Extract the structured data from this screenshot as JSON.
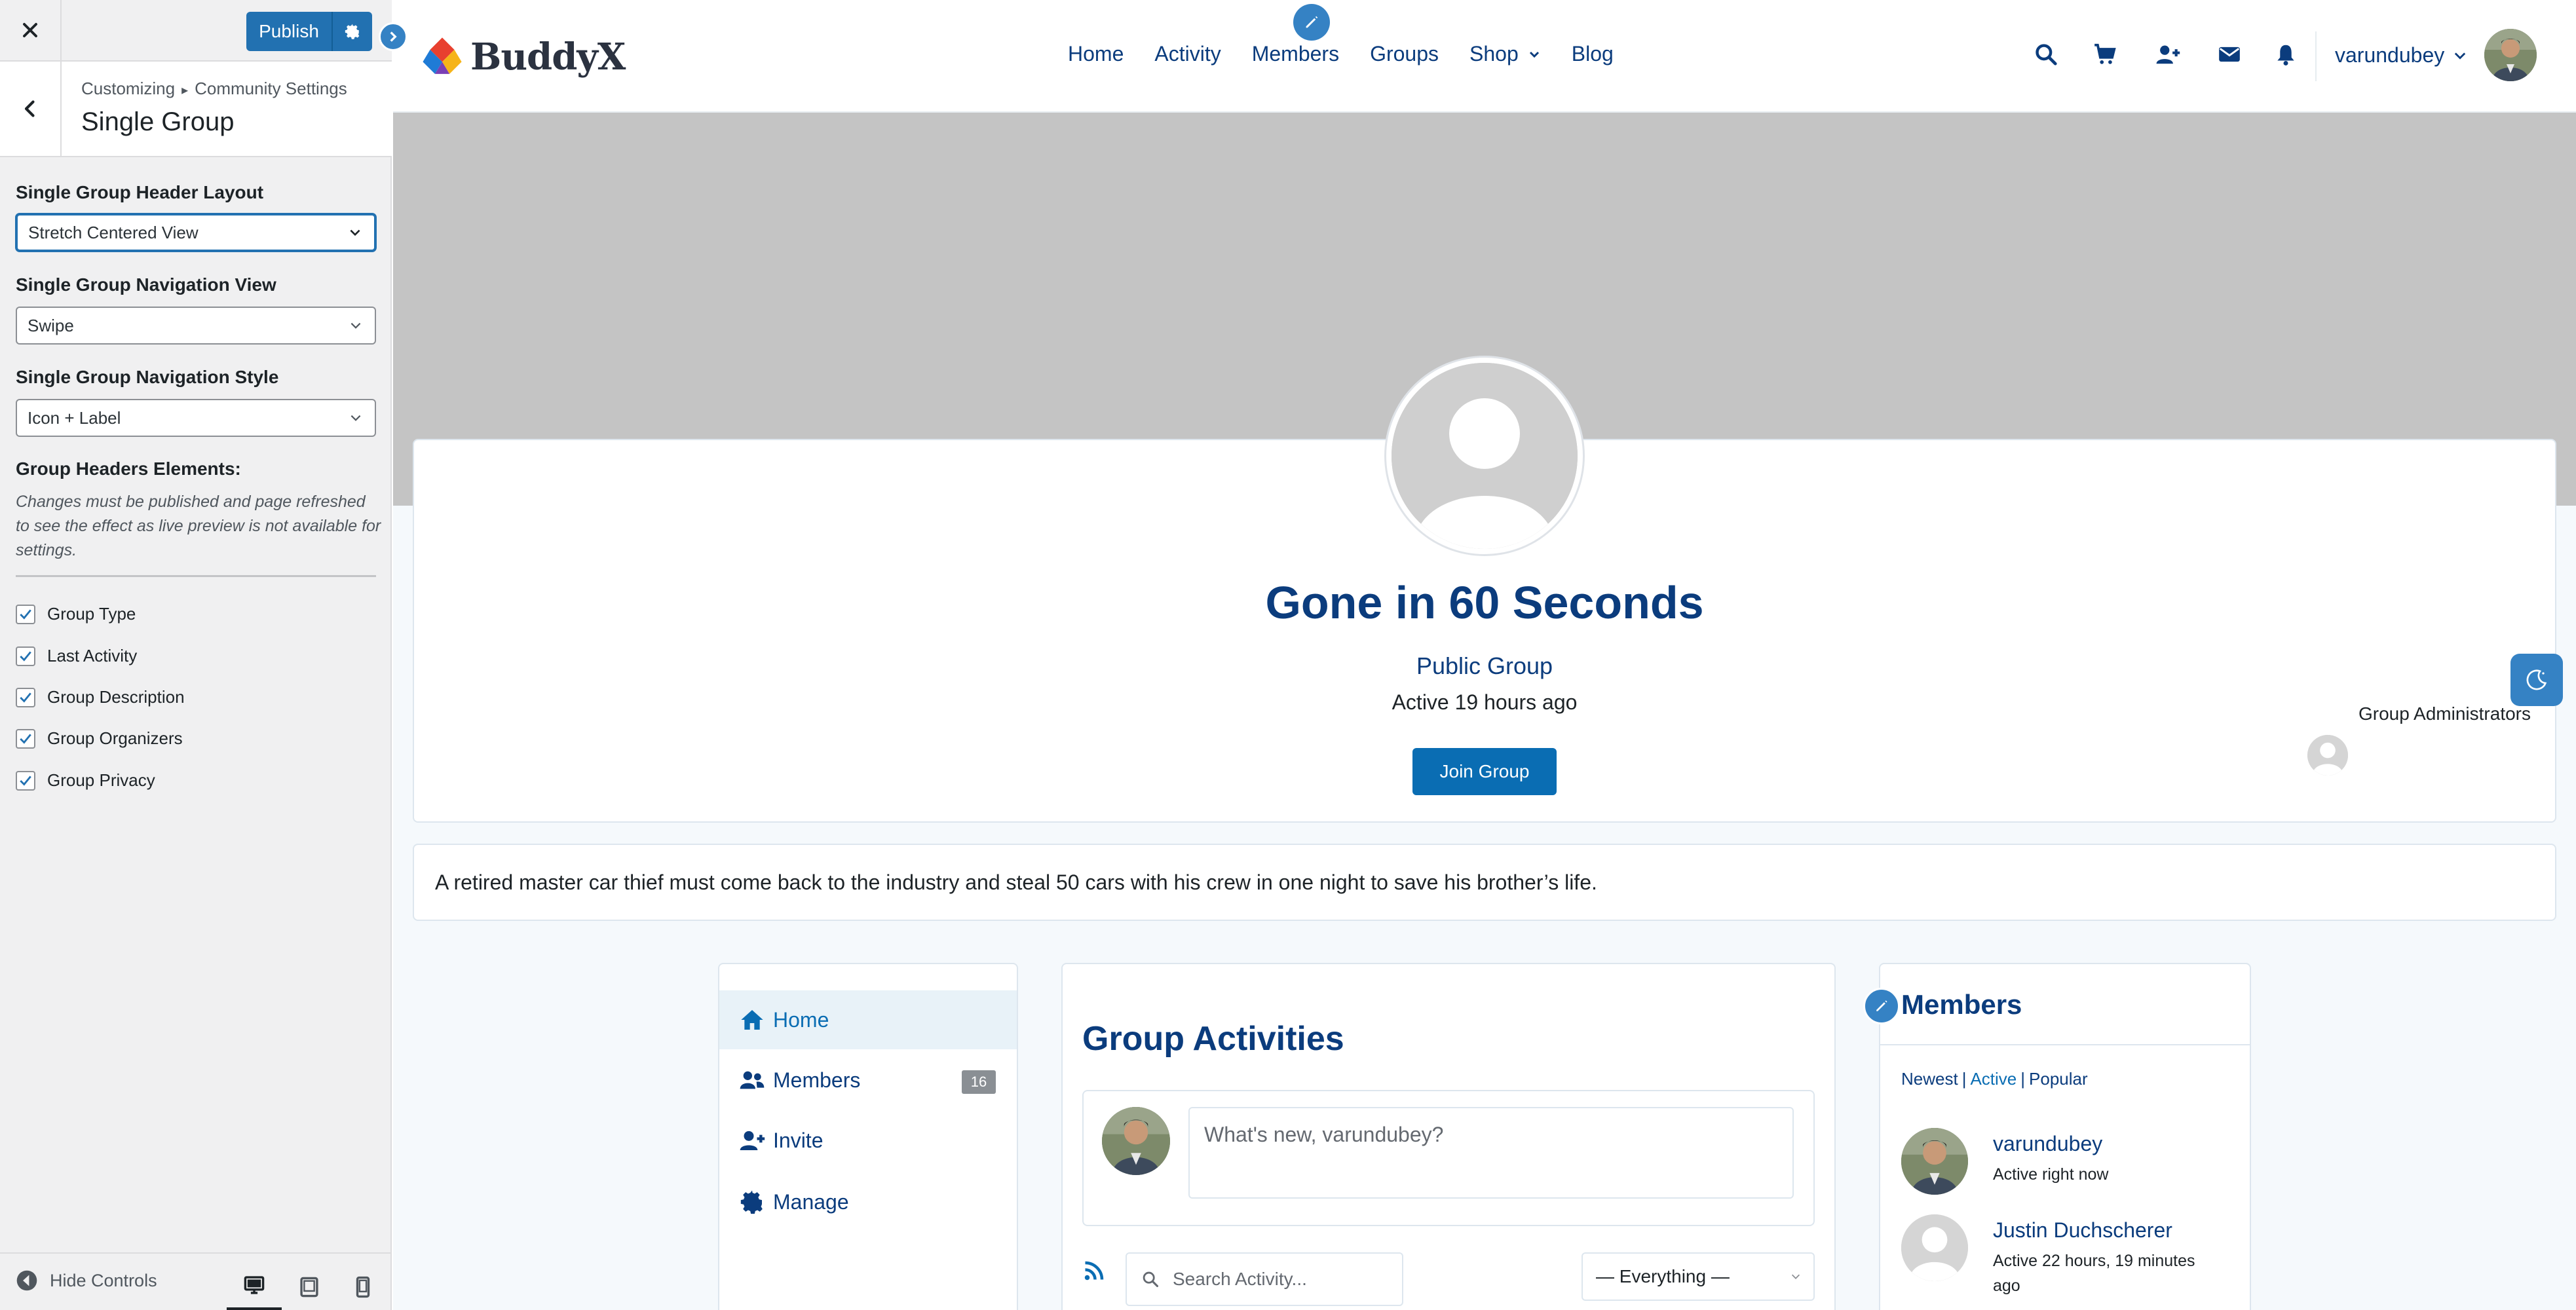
{
  "customizer": {
    "publish_label": "Publish",
    "breadcrumb_parent": "Customizing",
    "breadcrumb_separator": "▸",
    "breadcrumb_section": "Community Settings",
    "section_title": "Single Group",
    "header_layout": {
      "label": "Single Group Header Layout",
      "value": "Stretch Centered View"
    },
    "navigation_view": {
      "label": "Single Group Navigation View",
      "value": "Swipe"
    },
    "navigation_style": {
      "label": "Single Group Navigation Style",
      "value": "Icon + Label"
    },
    "header_elements": {
      "label": "Group Headers Elements:",
      "help": "Changes must be published and page refreshed to see the effect as live preview is not available for settings.",
      "items": [
        {
          "label": "Group Type",
          "checked": true
        },
        {
          "label": "Last Activity",
          "checked": true
        },
        {
          "label": "Group Description",
          "checked": true
        },
        {
          "label": "Group Organizers",
          "checked": true
        },
        {
          "label": "Group Privacy",
          "checked": true
        }
      ]
    },
    "hide_controls_label": "Hide Controls",
    "devices": [
      "desktop-icon",
      "tablet-icon",
      "mobile-icon"
    ],
    "active_device": "desktop"
  },
  "site": {
    "logo_text": "BuddyX",
    "nav": [
      "Home",
      "Activity",
      "Members",
      "Groups",
      "Shop",
      "Blog"
    ],
    "user_name": "varundubey",
    "header_icons": [
      "search-icon",
      "cart-icon",
      "add-friend-icon",
      "mail-icon",
      "bell-icon"
    ]
  },
  "group": {
    "name": "Gone in 60 Seconds",
    "type": "Public Group",
    "last_active": "Active 19 hours ago",
    "join_label": "Join Group",
    "admins_label": "Group Administrators",
    "description": "A retired master car thief must come back to the industry and steal 50 cars with his crew in one night to save his brother’s life."
  },
  "group_nav": {
    "items": [
      {
        "label": "Home",
        "icon": "home-icon",
        "active": true
      },
      {
        "label": "Members",
        "icon": "members-icon",
        "count": "16"
      },
      {
        "label": "Invite",
        "icon": "invite-icon"
      },
      {
        "label": "Manage",
        "icon": "gear-icon"
      }
    ]
  },
  "activity": {
    "title": "Group Activities",
    "post_placeholder": "What's new, varundubey?",
    "search_placeholder": "Search Activity...",
    "filter_value": "— Everything —"
  },
  "members_widget": {
    "title": "Members",
    "filters": [
      "Newest",
      "Active",
      "Popular"
    ],
    "active_filter": "Active",
    "members": [
      {
        "name": "varundubey",
        "status": "Active right now"
      },
      {
        "name": "Justin Duchscherer",
        "status": "Active 22 hours, 19 minutes ago"
      }
    ]
  },
  "colors": {
    "brand_blue": "#0b3c7d",
    "accent_blue": "#0a6db3",
    "wp_blue": "#2271b1",
    "cover_gray": "#c4c4c4"
  }
}
